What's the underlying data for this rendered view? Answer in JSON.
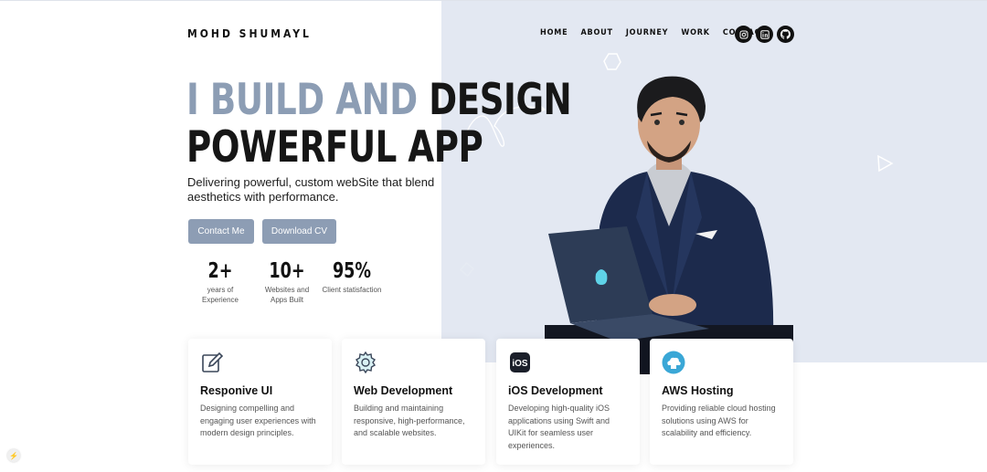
{
  "brand": "MOHD SHUMAYL",
  "nav": [
    "HOME",
    "ABOUT",
    "JOURNEY",
    "WORK",
    "CONTACT"
  ],
  "socials": [
    {
      "icon": "instagram-icon"
    },
    {
      "icon": "linkedin-icon"
    },
    {
      "icon": "github-icon"
    }
  ],
  "hero": {
    "headline_muted": "I BUILD AND",
    "headline_dark_1": "DESIGN",
    "headline_dark_2": "POWERFUL APP",
    "tagline": "Delivering powerful, custom webSite that blend aesthetics with performance.",
    "contact_label": "Contact Me",
    "cv_label": "Download CV"
  },
  "stats": [
    {
      "num": "2+",
      "label": "years of Experience"
    },
    {
      "num": "10+",
      "label": "Websites and Apps Built"
    },
    {
      "num": "95%",
      "label": "Client statisfaction"
    }
  ],
  "services": [
    {
      "icon": "edit-icon",
      "title": "Responive UI",
      "desc": "Designing compelling and engaging user experiences with modern design principles."
    },
    {
      "icon": "gear-icon",
      "title": "Web Development",
      "desc": "Building and maintaining responsive, high-performance, and scalable websites."
    },
    {
      "icon": "ios-icon",
      "title": "iOS Development",
      "desc": "Developing high-quality iOS applications using Swift and UIKit for seamless user experiences."
    },
    {
      "icon": "cloud-icon",
      "title": "AWS Hosting",
      "desc": "Providing reliable cloud hosting solutions using AWS for scalability and efficiency."
    }
  ],
  "colors": {
    "accent": "#8d9db4",
    "hero_bg": "#e3e8f2",
    "dark": "#111111"
  }
}
